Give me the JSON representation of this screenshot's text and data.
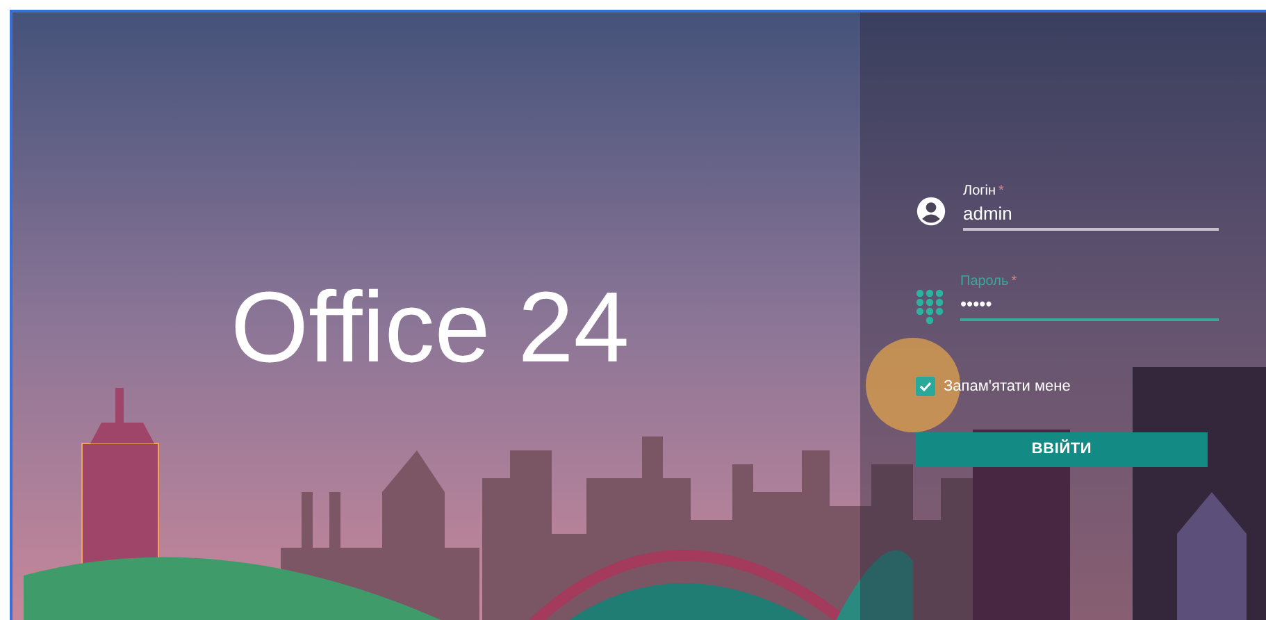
{
  "title": "Office 24",
  "login_form": {
    "fields": [
      {
        "kind": "user",
        "label": "Логін",
        "required_mark": "*",
        "value": "admin",
        "focused": false
      },
      {
        "kind": "password",
        "label": "Пароль",
        "required_mark": "*",
        "value": "•••••",
        "focused": true
      }
    ],
    "remember": {
      "label": "Запам'ятати мене",
      "checked": true
    },
    "submit": "ВВІЙТИ"
  }
}
